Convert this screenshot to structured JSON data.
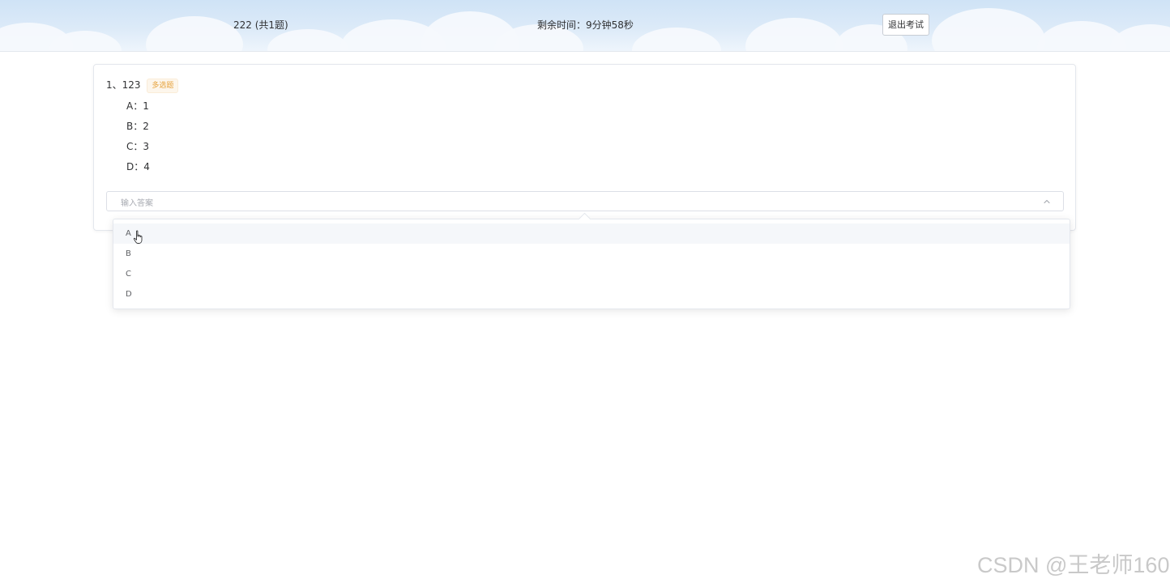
{
  "header": {
    "exam_title": "222 (共1题)",
    "timer": "剩余时间：9分钟58秒",
    "exit_button": "退出考试"
  },
  "question": {
    "title": "1、123",
    "type_tag": "多选题",
    "options": [
      {
        "label": "A：1"
      },
      {
        "label": "B：2"
      },
      {
        "label": "C：3"
      },
      {
        "label": "D：4"
      }
    ]
  },
  "answer_select": {
    "placeholder": "输入答案",
    "arrow_icon": "chevron-up-icon",
    "expanded": true,
    "options": [
      "A",
      "B",
      "C",
      "D"
    ],
    "hovered_option": "A"
  },
  "watermark": "CSDN @王老师160",
  "colors": {
    "tag_text": "#e6a23c",
    "tag_background": "#fdf6ec",
    "header_sky": "#cfe3f6"
  }
}
